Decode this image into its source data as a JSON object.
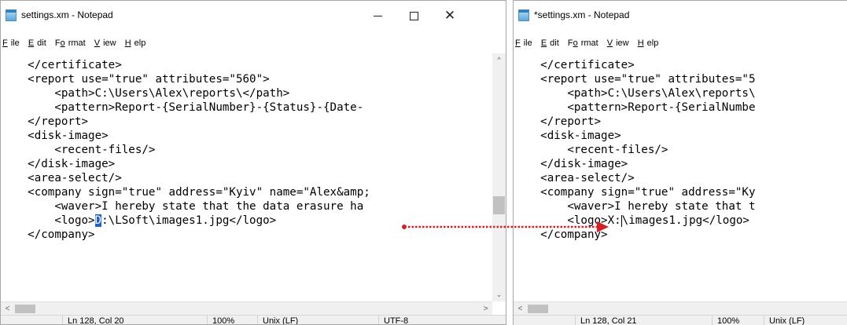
{
  "left_window": {
    "title": "settings.xm - Notepad",
    "menu": [
      "File",
      "Edit",
      "Format",
      "View",
      "Help"
    ],
    "lines": [
      "    </certificate>",
      "    <report use=\"true\" attributes=\"560\">",
      "        <path>C:\\Users\\Alex\\reports\\</path>",
      "        <pattern>Report-{SerialNumber}-{Status}-{Date-",
      "    </report>",
      "    <disk-image>",
      "        <recent-files/>",
      "    </disk-image>",
      "    <area-select/>",
      "    <company sign=\"true\" address=\"Kyiv\" name=\"Alex&amp;",
      "        <waver>I hereby state that the data erasure ha",
      "        <logo>"
    ],
    "logo_selected_char": "D",
    "logo_rest": ":\\LSoft\\images1.jpg</logo>",
    "last_line": "    </company>",
    "status": {
      "position": "Ln 128, Col 20",
      "zoom": "100%",
      "line_ending": "Unix (LF)",
      "encoding": "UTF-8"
    }
  },
  "right_window": {
    "title": "*settings.xm - Notepad",
    "menu": [
      "File",
      "Edit",
      "Format",
      "View",
      "Help"
    ],
    "lines": [
      "    </certificate>",
      "    <report use=\"true\" attributes=\"5",
      "        <path>C:\\Users\\Alex\\reports\\",
      "        <pattern>Report-{SerialNumbe",
      "    </report>",
      "    <disk-image>",
      "        <recent-files/>",
      "    </disk-image>",
      "    <area-select/>",
      "    <company sign=\"true\" address=\"Ky",
      "        <waver>I hereby state that t",
      "        <logo>X:"
    ],
    "logo_rest": "\\images1.jpg</logo>",
    "last_line": "    </company>",
    "status": {
      "position": "Ln 128, Col 21",
      "zoom": "100%",
      "line_ending": "Unix (LF)"
    }
  },
  "colors": {
    "arrow": "#d42020",
    "selection": "#1a63d1"
  }
}
